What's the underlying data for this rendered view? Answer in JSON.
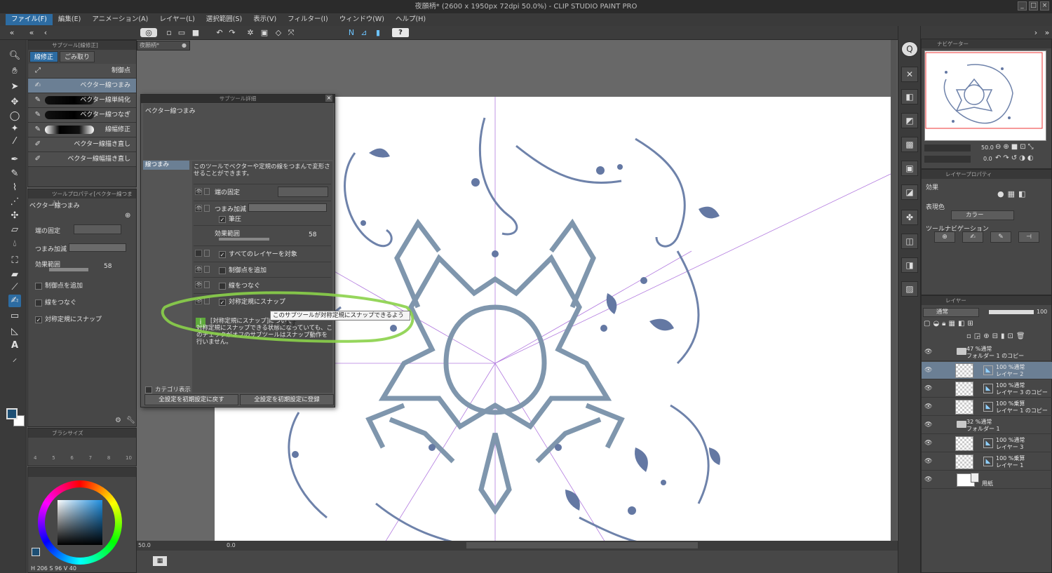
{
  "window": {
    "title": "夜願柄* (2600 x 1950px 72dpi 50.0%) - CLIP STUDIO PAINT PRO"
  },
  "menu": [
    "ファイル(F)",
    "編集(E)",
    "アニメーション(A)",
    "レイヤー(L)",
    "選択範囲(S)",
    "表示(V)",
    "フィルター(I)",
    "ウィンドウ(W)",
    "ヘルプ(H)"
  ],
  "canvas_tab": "夜願柄*",
  "subtool": {
    "header": "サブツール[線修正]",
    "tabs": [
      "線修正",
      "ごみ取り"
    ],
    "items": [
      "制御点",
      "ベクター線つまみ",
      "ベクター線単純化",
      "ベクター線つなぎ",
      "線幅修正",
      "ベクター線描き直し",
      "ベクター線幅描き直し"
    ]
  },
  "toolprop": {
    "header": "ツールプロパティ[ベクター線つまみ]",
    "name": "ベクター線つまみ",
    "fix_ends": "端の固定",
    "pinch_accel": "つまみ加減",
    "effect_range": "効果範囲",
    "effect_value": "58",
    "add_control": "制御点を追加",
    "connect_lines": "線をつなぐ",
    "snap_symmetric": "対称定規にスナップ"
  },
  "brushsize": {
    "header": "ブラシサイズ",
    "sizes": [
      "4",
      "5",
      "6",
      "7",
      "8",
      "10"
    ]
  },
  "color": {
    "h": "206",
    "s": "96",
    "v": "40",
    "main": "#1d4f74",
    "sub": "#ffffff"
  },
  "dialog": {
    "title": "サブツール詳細",
    "subtool_name": "ベクター線つまみ",
    "category": "線つまみ",
    "description": "このツールでベクターや定規の線をつまんで変形させることができます。",
    "rows": [
      "端の固定",
      "つまみ加減",
      "筆圧",
      "効果範囲",
      "すべてのレイヤーを対象",
      "制御点を追加",
      "線をつなぐ",
      "対称定規にスナップ"
    ],
    "effect_value": "58",
    "tooltip": "このサブツールが対称定規にスナップできるようにします",
    "info_title": "[対称定規にスナップ]について",
    "info_text": "対称定規にスナップできる状態になっていても、このチェックがオフのサブツールはスナップ動作を行いません。",
    "show_category": "カテゴリ表示",
    "reset_btn": "全設定を初期設定に戻す",
    "register_btn": "全設定を初期設定に登録"
  },
  "status": {
    "zoom": "50.0",
    "angle": "0.0"
  },
  "navigator": {
    "header": "ナビゲーター",
    "zoom": "50.0",
    "angle": "0.0"
  },
  "layerprop": {
    "header": "レイヤープロパティ",
    "effect": "効果",
    "express_color": "表現色",
    "color_mode": "カラー",
    "tool_nav": "ツールナビゲーション"
  },
  "layers": {
    "header": "レイヤー",
    "blend": "通常",
    "opacity": "100",
    "items": [
      {
        "mode": "47 %通常",
        "name": "フォルダー 1 のコピー",
        "type": "folder"
      },
      {
        "mode": "100 %通常",
        "name": "レイヤー 2",
        "type": "vector",
        "selected": true
      },
      {
        "mode": "100 %通常",
        "name": "レイヤー 3 のコピー",
        "type": "vector"
      },
      {
        "mode": "100 %乗算",
        "name": "レイヤー 1 のコピー",
        "type": "vector"
      },
      {
        "mode": "32 %通常",
        "name": "フォルダー 1",
        "type": "folder"
      },
      {
        "mode": "100 %通常",
        "name": "レイヤー 3",
        "type": "vector"
      },
      {
        "mode": "100 %乗算",
        "name": "レイヤー 1",
        "type": "vector"
      },
      {
        "mode": "",
        "name": "用紙",
        "type": "paper"
      }
    ]
  }
}
